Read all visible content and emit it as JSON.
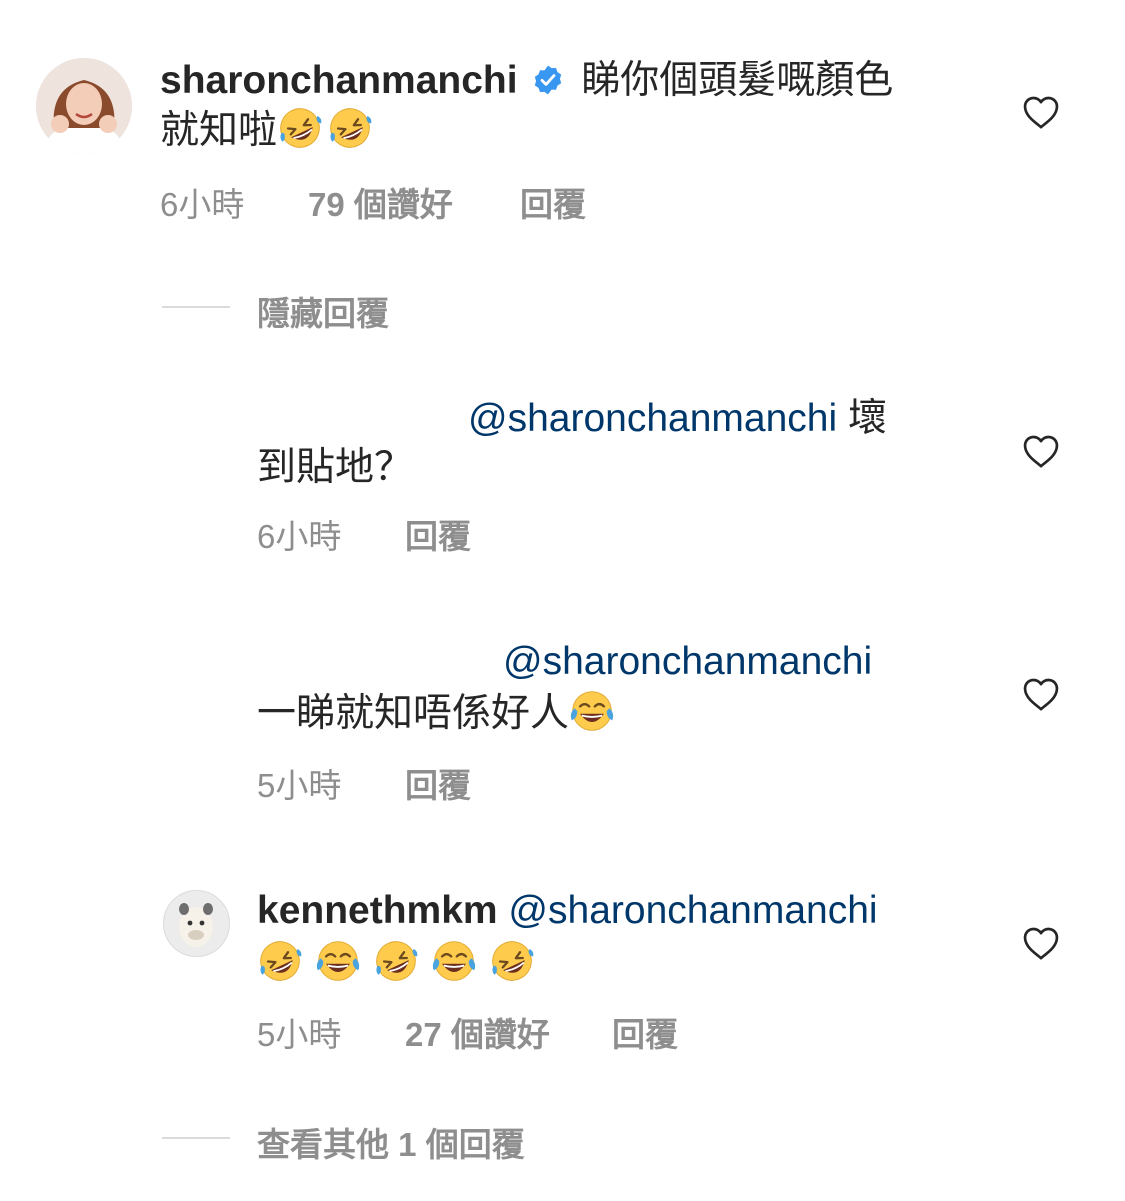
{
  "comment1": {
    "username": "sharonchanmanchi",
    "text_line1": "睇你個頭髮嘅顏色",
    "text_line2": "就知啦",
    "emojis": [
      "rofl-emoji",
      "rofl-emoji"
    ],
    "time": "6小時",
    "likes": "79 個讚好",
    "reply": "回覆",
    "hide_replies": "隱藏回覆"
  },
  "reply1": {
    "mention": "@sharonchanmanchi",
    "text_tail": "壞",
    "text_line2": "到貼地？",
    "time": "6小時",
    "reply": "回覆"
  },
  "reply2": {
    "mention": "@sharonchanmanchi",
    "text_line2": "一睇就知唔係好人",
    "emojis": [
      "tears-of-joy-emoji"
    ],
    "time": "5小時",
    "reply": "回覆"
  },
  "reply3": {
    "username": "kennethmkm",
    "mention": "@sharonchanmanchi",
    "emojis": [
      "rofl-emoji",
      "tears-of-joy-emoji",
      "rofl-emoji",
      "tears-of-joy-emoji",
      "rofl-emoji"
    ],
    "time": "5小時",
    "likes": "27 個讚好",
    "reply": "回覆",
    "view_more": "查看其他 1 個回覆"
  },
  "colors": {
    "mention": "#00376b",
    "secondary_text": "#8e8e8e",
    "verified": "#3897f0",
    "emoji_face": "#ffcb4c"
  }
}
